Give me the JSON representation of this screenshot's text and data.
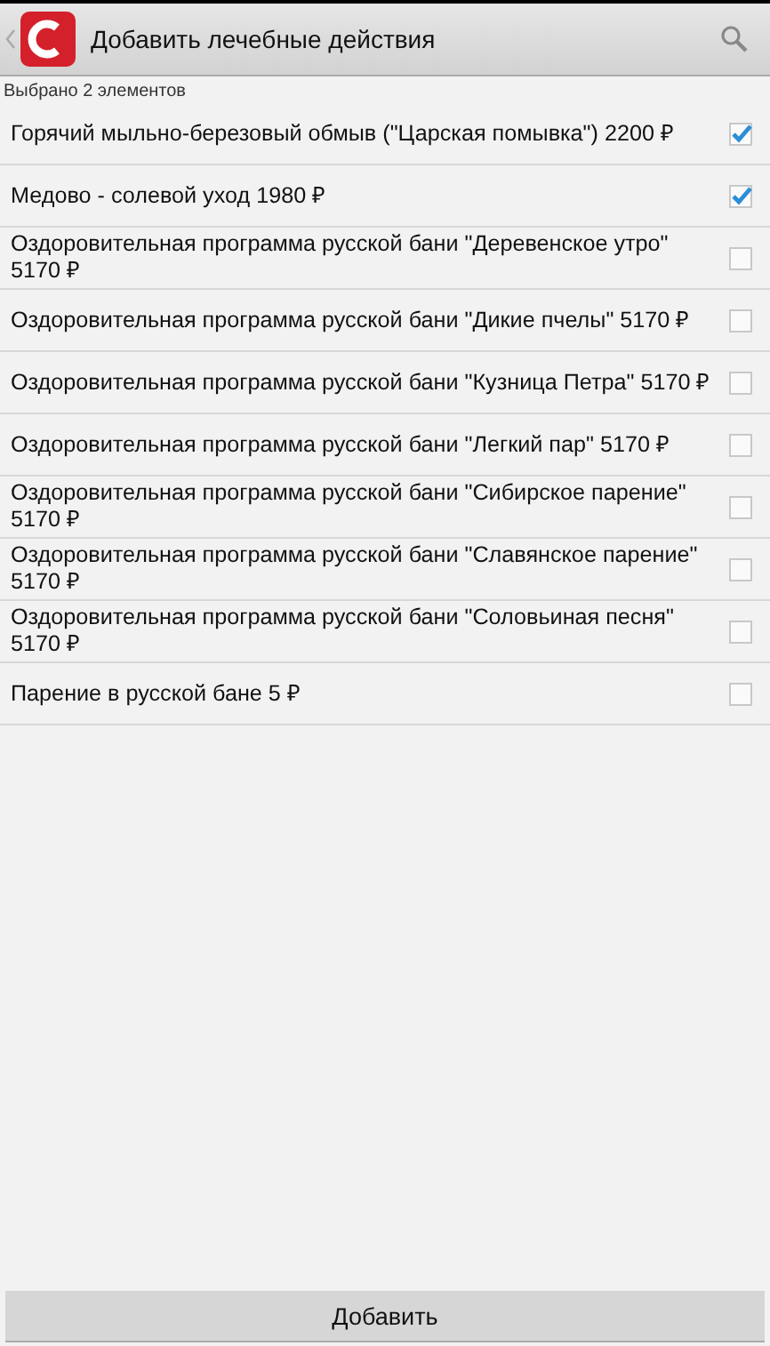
{
  "header": {
    "title": "Добавить лечебные действия"
  },
  "selection_summary": "Выбрано  2 элементов",
  "items": [
    {
      "label": "Горячий мыльно-березовый обмыв (\"Царская помывка\") 2200 ₽",
      "checked": true
    },
    {
      "label": "Медово - солевой уход 1980 ₽",
      "checked": true
    },
    {
      "label": "Оздоровительная программа русской бани \"Деревенское утро\" 5170 ₽",
      "checked": false
    },
    {
      "label": "Оздоровительная программа русской бани \"Дикие пчелы\" 5170 ₽",
      "checked": false
    },
    {
      "label": "Оздоровительная программа русской бани \"Кузница Петра\" 5170 ₽",
      "checked": false
    },
    {
      "label": "Оздоровительная программа русской бани \"Легкий пар\" 5170 ₽",
      "checked": false
    },
    {
      "label": "Оздоровительная программа русской бани \"Сибирское парение\" 5170 ₽",
      "checked": false
    },
    {
      "label": "Оздоровительная программа русской бани \"Славянское парение\" 5170 ₽",
      "checked": false
    },
    {
      "label": "Оздоровительная программа русской бани \"Соловьиная песня\" 5170 ₽",
      "checked": false
    },
    {
      "label": "Парение в русской бане 5 ₽",
      "checked": false
    }
  ],
  "add_button": "Добавить"
}
